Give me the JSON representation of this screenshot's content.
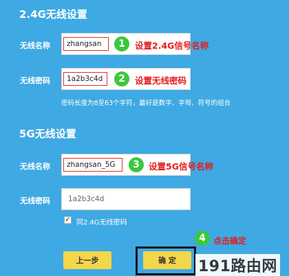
{
  "section_24g": {
    "title": "2.4G无线设置",
    "ssid_label": "无线名称",
    "ssid_value": "zhangsan",
    "ssid_note": "设置2.4G信号名称",
    "password_label": "无线密码",
    "password_value": "1a2b3c4d",
    "password_note": "设置无线密码",
    "password_hint": "密码长度为8至63个字符，最好是数字、字母、符号的组合"
  },
  "section_5g": {
    "title": "5G无线设置",
    "ssid_label": "无线名称",
    "ssid_value": "zhangsan_5G",
    "ssid_note": "设置5G信号名称",
    "password_label": "无线密码",
    "password_placeholder": "1a2b3c4d",
    "same_password_label": "同2.4G无线密码",
    "same_password_checked": true
  },
  "steps": {
    "step1": "1",
    "step2": "2",
    "step3": "3",
    "step4": "4",
    "step4_note": "点击确定"
  },
  "buttons": {
    "back": "上一步",
    "confirm": "确 定"
  },
  "watermark": "191路由网",
  "colors": {
    "background": "#3fa9e3",
    "badge": "#3ac93a",
    "annotation": "#e51b1b",
    "button": "#f4d64a"
  }
}
